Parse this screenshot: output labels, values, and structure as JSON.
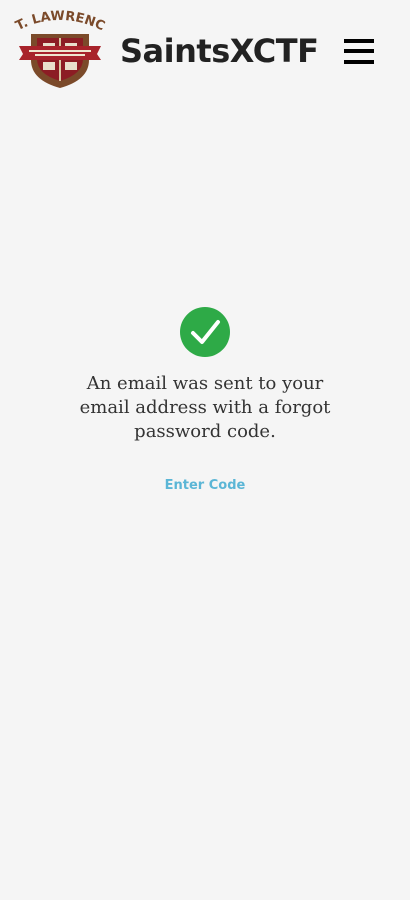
{
  "header": {
    "logo_text": "ST. LAWRENCE",
    "site_title": "SaintsXCTF",
    "menu_icon": "hamburger-menu-icon"
  },
  "main": {
    "status_icon": "checkmark-icon",
    "status_color": "#2eaa47",
    "message": "An email was sent to your email address with a forgot password code.",
    "enter_code_label": "Enter Code",
    "link_color": "#5bb6d6"
  }
}
